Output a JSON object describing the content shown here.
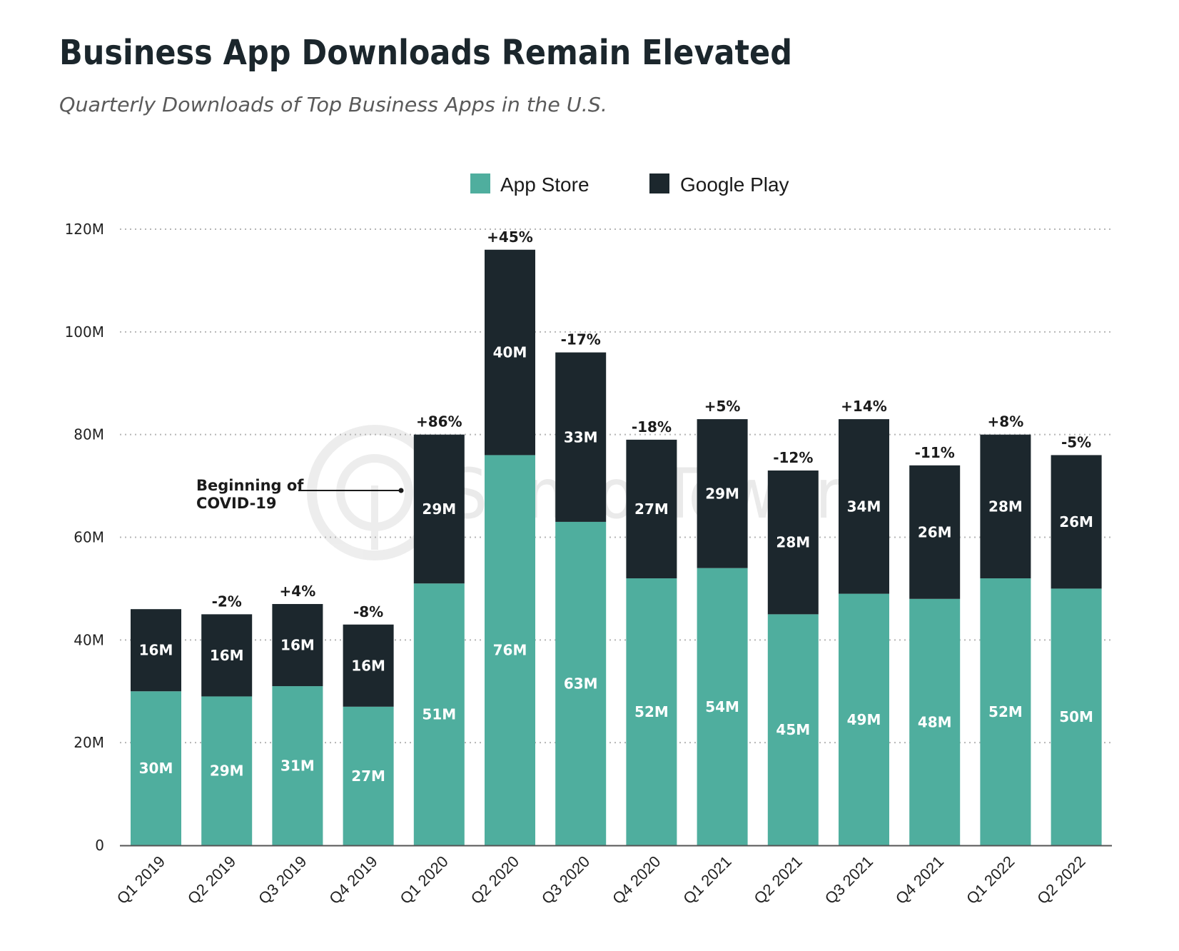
{
  "chart_data": {
    "type": "bar",
    "stacked": true,
    "title": "Business App Downloads Remain Elevated",
    "subtitle": "Quarterly Downloads of Top Business Apps in the U.S.",
    "xlabel": "",
    "ylabel": "",
    "ylim": [
      0,
      120
    ],
    "yticks": [
      0,
      20,
      40,
      60,
      80,
      100,
      120
    ],
    "ytick_labels": [
      "0",
      "20M",
      "40M",
      "60M",
      "80M",
      "100M",
      "120M"
    ],
    "grid": true,
    "legend_position": "top-center",
    "categories": [
      "Q1 2019",
      "Q2 2019",
      "Q3 2019",
      "Q4 2019",
      "Q1 2020",
      "Q2 2020",
      "Q3 2020",
      "Q4 2020",
      "Q1 2021",
      "Q2 2021",
      "Q3 2021",
      "Q4 2021",
      "Q1 2022",
      "Q2 2022"
    ],
    "series": [
      {
        "name": "App Store",
        "color": "#4fae9e",
        "values": [
          30,
          29,
          31,
          27,
          51,
          76,
          63,
          52,
          54,
          45,
          49,
          48,
          52,
          50
        ],
        "labels": [
          "30M",
          "29M",
          "31M",
          "27M",
          "51M",
          "76M",
          "63M",
          "52M",
          "54M",
          "45M",
          "49M",
          "48M",
          "52M",
          "50M"
        ]
      },
      {
        "name": "Google Play",
        "color": "#1c272d",
        "values": [
          16,
          16,
          16,
          16,
          29,
          40,
          33,
          27,
          29,
          28,
          34,
          26,
          28,
          26
        ],
        "labels": [
          "16M",
          "16M",
          "16M",
          "16M",
          "29M",
          "40M",
          "33M",
          "27M",
          "29M",
          "28M",
          "34M",
          "26M",
          "28M",
          "26M"
        ]
      }
    ],
    "change_labels": [
      "",
      "-2%",
      "+4%",
      "-8%",
      "+86%",
      "+45%",
      "-17%",
      "-18%",
      "+5%",
      "-12%",
      "+14%",
      "-11%",
      "+8%",
      "-5%"
    ],
    "annotations": [
      {
        "text_lines": [
          "Beginning of",
          "COVID-19"
        ],
        "points_to": "Q1 2020"
      }
    ]
  },
  "legend": {
    "items": [
      {
        "label": "App Store",
        "color": "#4fae9e"
      },
      {
        "label": "Google Play",
        "color": "#1c272d"
      }
    ]
  },
  "watermark": {
    "text": "SensorTower"
  }
}
